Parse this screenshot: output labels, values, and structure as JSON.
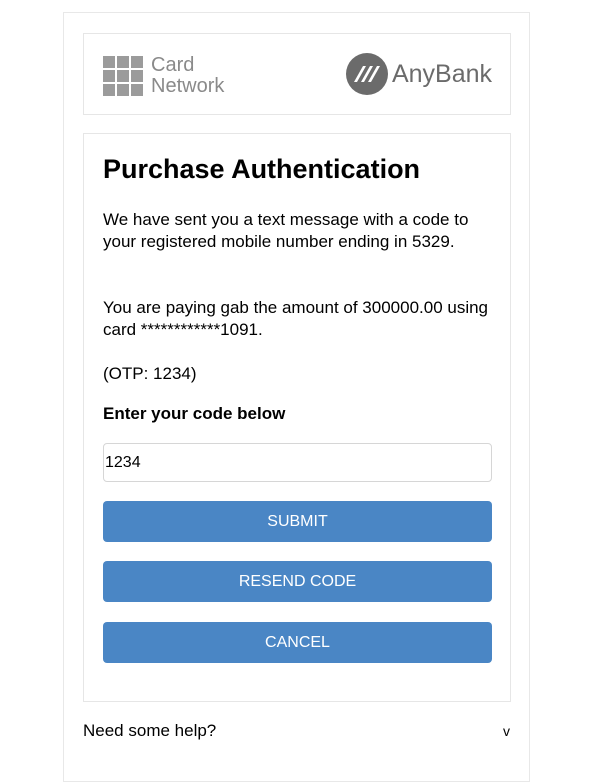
{
  "header": {
    "card_network_line1": "Card",
    "card_network_line2": "Network",
    "bank_name": "AnyBank"
  },
  "auth": {
    "title": "Purchase Authentication",
    "message_sent": "We have sent you a text message with a code to your registered mobile number ending in 5329.",
    "payment_info": "You are paying gab the amount of 300000.00 using card ************1091.",
    "otp_hint": "(OTP: 1234)",
    "code_label": "Enter your code below",
    "code_value": "1234"
  },
  "buttons": {
    "submit": "SUBMIT",
    "resend": "RESEND CODE",
    "cancel": "CANCEL"
  },
  "help": {
    "label": "Need some help?",
    "toggle": "v"
  },
  "colors": {
    "button_bg": "#4a86c5",
    "logo_gray": "#8a8a8a"
  },
  "icons": {
    "card_network": "grid-logo-icon",
    "bank": "anybank-logo-icon",
    "help_toggle": "chevron-down-icon"
  }
}
